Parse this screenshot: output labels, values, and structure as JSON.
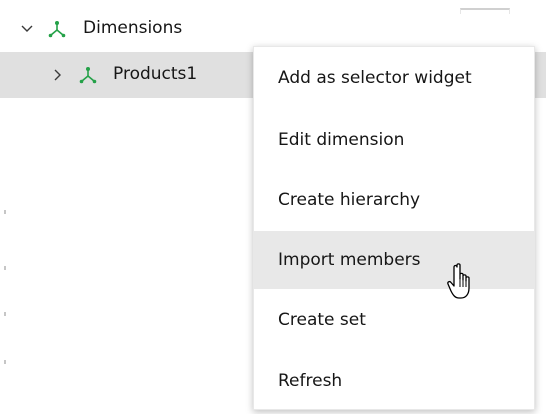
{
  "tree": {
    "dimensions": {
      "label": "Dimensions",
      "expanded": true,
      "icon": "hierarchy-icon"
    },
    "products": {
      "label": "Products1",
      "expanded": false,
      "selected": true,
      "icon": "hierarchy-icon"
    }
  },
  "context_menu": {
    "items": [
      {
        "label": "Add as selector widget"
      },
      {
        "label": "Edit dimension"
      },
      {
        "label": "Create hierarchy"
      },
      {
        "label": "Import members",
        "hovered": true
      },
      {
        "label": "Create set"
      },
      {
        "label": "Refresh"
      }
    ]
  },
  "colors": {
    "icon_green": "#24a148",
    "selected_row": "#e0e0e0",
    "hover_item": "#e8e8e8",
    "text": "#161616"
  },
  "cursor": "hand-pointer-icon"
}
